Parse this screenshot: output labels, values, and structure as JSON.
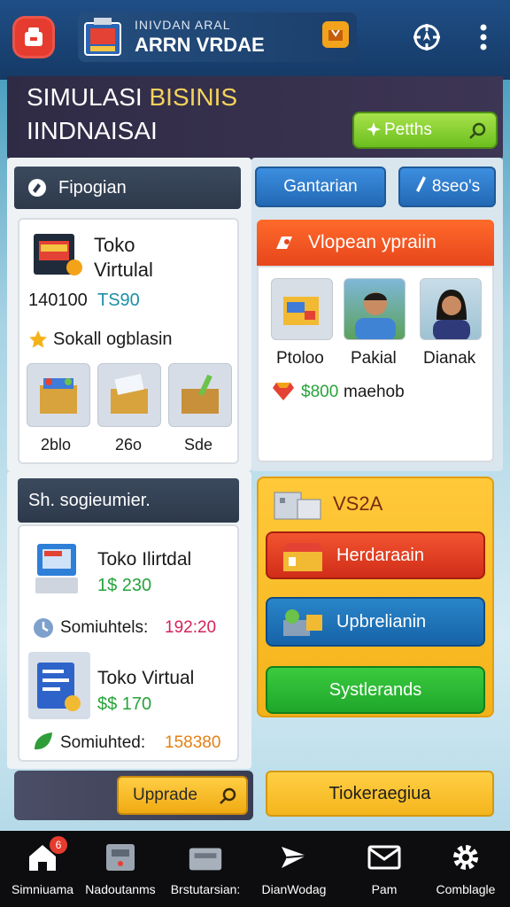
{
  "topbar": {
    "subtitle": "INIVDAN ARAL",
    "title": "ARRN VRDAE"
  },
  "header": {
    "title_part1": "SIMULASI ",
    "title_part2": "BISINIS",
    "title_line2": "IINDNAISAI",
    "action_label": "Petths"
  },
  "left_panel_a": {
    "heading": "Fipogian",
    "product_name_line1": "Toko",
    "product_name_line2": "Virtulal",
    "stat_left": "140100",
    "stat_right": "TS90",
    "rating_text": "Sokall ogblasin",
    "items": [
      {
        "label": "2blo"
      },
      {
        "label": "26o"
      },
      {
        "label": "Sde"
      }
    ]
  },
  "tabs": {
    "tab1": "Gantarian",
    "tab2": "8seo's"
  },
  "right_panel_a": {
    "heading": "Vlopean ypraiin",
    "people": [
      {
        "label": "Ptoloo"
      },
      {
        "label": "Pakial"
      },
      {
        "label": "Dianak"
      }
    ],
    "reward_amount": "$800",
    "reward_text": "maehob"
  },
  "left_panel_b": {
    "heading": "Sh. sogieumier.",
    "entries": [
      {
        "name": "Toko Ilirtdal",
        "price": "1$ 230"
      },
      {
        "name": "Toko Virtual",
        "price": "$$ 170"
      }
    ],
    "stat1_label": "Somiuhtels:",
    "stat1_value": "192:20",
    "stat2_label": "Somiuhted:",
    "stat2_value": "158380"
  },
  "right_panel_b": {
    "heading": "VS2A",
    "btn_red": "Herdaraain",
    "btn_blue": "Upbrelianin",
    "btn_green": "Systlerands"
  },
  "footer_actions": {
    "upgrade": "Upprade",
    "ticket": "Tiokeraegiua"
  },
  "bottom_nav": {
    "badge": "6",
    "items": [
      {
        "label": "Simniuama"
      },
      {
        "label": "Nadoutanms"
      },
      {
        "label": "Brstutarsian:"
      },
      {
        "label": "DianWodag"
      },
      {
        "label": "Pam"
      },
      {
        "label": "Comblagle"
      }
    ]
  },
  "colors": {
    "accent_orange": "#e7461c",
    "accent_yellow": "#f4b21a",
    "accent_green": "#6bbf1e",
    "accent_blue": "#2369b5",
    "price_green": "#27a33a",
    "price_red": "#d6225a"
  }
}
